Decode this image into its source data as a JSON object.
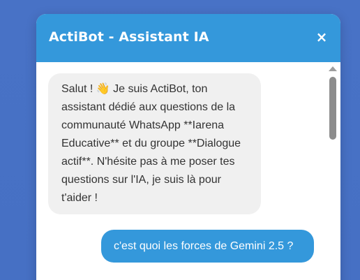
{
  "header": {
    "title": "ActiBot - Assistant IA",
    "close_label": "×"
  },
  "messages": [
    {
      "role": "bot",
      "text": "Salut ! 👋 Je suis ActiBot, ton assistant dédié aux questions de la communauté WhatsApp **Iarena Educative** et du groupe **Dialogue actif**. N'hésite pas à me poser tes questions sur l'IA, je suis là pour t'aider !"
    },
    {
      "role": "user",
      "text": "c'est quoi les forces de Gemini 2.5 ?"
    }
  ],
  "colors": {
    "background": "#4670c4",
    "header": "#3498db",
    "bot_bubble": "#f0f0f0",
    "user_bubble": "#3498db"
  },
  "icons": {
    "close": "close-icon",
    "scroll_up": "scroll-up-arrow-icon"
  }
}
